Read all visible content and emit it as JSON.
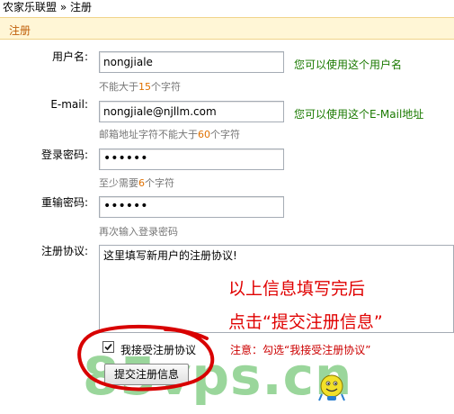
{
  "breadcrumb": {
    "home": "农家乐联盟",
    "sep": "»",
    "current": "注册"
  },
  "section_title": "注册",
  "form": {
    "username": {
      "label": "用户名:",
      "value": "nongjiale",
      "ok_msg": "您可以使用这个用户名",
      "hint_pre": "不能大于",
      "hint_num": "15",
      "hint_post": "个字符"
    },
    "email": {
      "label": "E-mail:",
      "value": "nongjiale@njllm.com",
      "ok_msg": "您可以使用这个E-Mail地址",
      "hint_pre": "邮箱地址字符不能大于",
      "hint_num": "60",
      "hint_post": "个字符"
    },
    "password": {
      "label": "登录密码:",
      "value": "••••••",
      "hint_pre": "至少需要",
      "hint_num": "6",
      "hint_post": "个字符"
    },
    "password_confirm": {
      "label": "重输密码:",
      "value": "••••••",
      "hint": "再次输入登录密码"
    },
    "agreement": {
      "label": "注册协议:",
      "text": "这里填写新用户的注册协议!"
    },
    "accept_checkbox": {
      "label": "我接受注册协议",
      "checked": true
    },
    "submit_label": "提交注册信息"
  },
  "annotation": {
    "line1": "以上信息填写完后",
    "line2": "点击“提交注册信息”",
    "note": "注意：勾选“我接受注册协议”",
    "circle_color": "#d80000"
  },
  "watermark": "85vps.cn",
  "colors": {
    "header_bg": "#fff6d6",
    "header_text": "#c0600a",
    "ok_green": "#1a7a00",
    "hint_num": "#e07000",
    "annotation_red": "#e00000",
    "watermark_green": "#49b54a"
  }
}
